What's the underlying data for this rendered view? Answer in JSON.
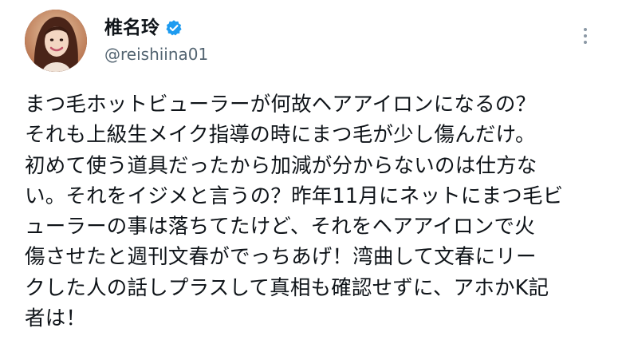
{
  "tweet": {
    "author": {
      "display_name": "椎名玲",
      "handle": "@reishiina01",
      "verified_icon": "verified-badge-icon",
      "avatar": "profile-photo"
    },
    "more_icon": "more-vertical-icon",
    "lines": [
      "まつ毛ホットビューラーが何故ヘアアイロンになるの？",
      "それも上級生メイク指導の時にまつ毛が少し傷んだけ。",
      "初めて使う道具だったから加減が分からないのは仕方な",
      "い。それをイジメと言うの？昨年11月にネットにまつ毛ビ",
      "ューラーの事は落ちてたけど、それをヘアアイロンで火",
      "傷させたと週刊文春がでっちあげ！湾曲して文春にリー",
      "クした人の話しプラスして真相も確認せずに、アホかK記",
      "者は！"
    ]
  },
  "colors": {
    "text": "#0f1419",
    "secondary": "#536471",
    "verified": "#1d9bf0",
    "background": "#ffffff"
  }
}
